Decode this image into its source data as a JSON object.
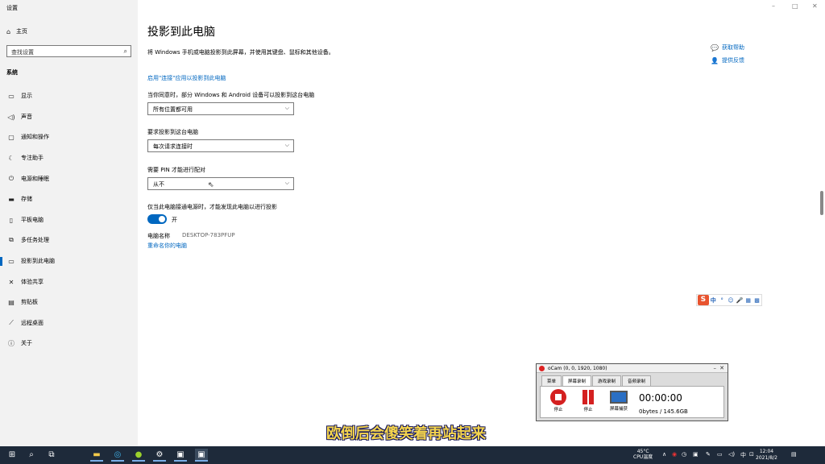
{
  "window": {
    "title": "设置",
    "minimize": "–",
    "maximize": "□",
    "close": "✕"
  },
  "sidebar": {
    "home": "主页",
    "search_placeholder": "查找设置",
    "section": "系统",
    "items": [
      {
        "label": "显示",
        "icon": "display-icon"
      },
      {
        "label": "声音",
        "icon": "sound-icon"
      },
      {
        "label": "通知和操作",
        "icon": "notification-icon"
      },
      {
        "label": "专注助手",
        "icon": "focus-assist-icon"
      },
      {
        "label": "电源和睡眠",
        "icon": "power-icon"
      },
      {
        "label": "存储",
        "icon": "storage-icon"
      },
      {
        "label": "平板电脑",
        "icon": "tablet-icon"
      },
      {
        "label": "多任务处理",
        "icon": "multitasking-icon"
      },
      {
        "label": "投影到此电脑",
        "icon": "project-icon",
        "active": true
      },
      {
        "label": "体验共享",
        "icon": "shared-experiences-icon"
      },
      {
        "label": "剪贴板",
        "icon": "clipboard-icon"
      },
      {
        "label": "远程桌面",
        "icon": "remote-desktop-icon"
      },
      {
        "label": "关于",
        "icon": "about-icon"
      }
    ]
  },
  "main": {
    "title": "投影到此电脑",
    "description": "将 Windows 手机或电脑投影到此屏幕，并使用其键盘、鼠标和其他设备。",
    "enable_link": "启用\"连接\"应用以投影到此电脑",
    "setting1": {
      "label": "当你同意时，部分 Windows 和 Android 设备可以投影到这台电脑",
      "value": "所有位置都可用"
    },
    "setting2": {
      "label": "要求投影到这台电脑",
      "value": "每次请求连接时"
    },
    "setting3": {
      "label": "需要 PIN 才能进行配对",
      "value": "从不"
    },
    "power_label": "仅当此电脑接通电源时，才能发现此电脑以进行投影",
    "toggle_state": "开",
    "toggle_on": true,
    "pc_name_label": "电脑名称",
    "pc_name_value": "DESKTOP-783PFUP",
    "rename_link": "重命名你的电脑"
  },
  "help": {
    "get_help": "获取帮助",
    "feedback": "提供反馈"
  },
  "ime": {
    "logo": "S",
    "lang": "中"
  },
  "ocam": {
    "title": "oCam (0, 0, 1920, 1080)",
    "tabs": [
      "菜单",
      "屏幕录制",
      "游戏录制",
      "音频录制"
    ],
    "stop_label": "停止",
    "pause_label": "停止",
    "screen_label": "屏幕捕获",
    "time": "00:00:00",
    "size": "0bytes / 145.6GB"
  },
  "subtitle": "欧倒后会傻笑着再站起来",
  "taskbar": {
    "temp": "45°C",
    "temp_label": "CPU温度",
    "ime_lang": "中",
    "time": "12:04",
    "date": "2021/8/2"
  }
}
